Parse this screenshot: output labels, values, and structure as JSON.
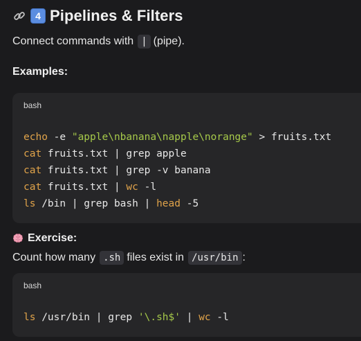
{
  "header": {
    "title": "Pipelines & Filters",
    "badge": "4"
  },
  "intro": {
    "prefix": "Connect commands with",
    "pipe": "|",
    "suffix": "(pipe)."
  },
  "examples": {
    "heading": "Examples:",
    "lang": "bash",
    "lines": [
      {
        "kw": "echo",
        "rest": " -e ",
        "str": "\"apple\\nbanana\\napple\\norange\"",
        "tail": " > fruits.txt"
      },
      {
        "kw": "cat",
        "rest": " fruits.txt | grep apple",
        "str": "",
        "tail": ""
      },
      {
        "kw": "cat",
        "rest": " fruits.txt | grep -v banana",
        "str": "",
        "tail": ""
      },
      {
        "kw": "cat",
        "rest": " fruits.txt | ",
        "kw2": "wc",
        "tail": " -l"
      },
      {
        "kw": "ls",
        "rest": " /bin | grep bash | ",
        "kw2": "head",
        "tail": " -5"
      }
    ]
  },
  "exercise": {
    "heading": "Exercise:",
    "prefix": "Count how many",
    "code1": ".sh",
    "middle": "files exist in",
    "code2": "/usr/bin",
    "suffix": ":",
    "lang": "bash",
    "line": {
      "kw": "ls",
      "rest": " /usr/bin | grep ",
      "str": "'\\.sh$'",
      "mid": " | ",
      "kw2": "wc",
      "tail": " -l"
    }
  },
  "colors": {
    "keyword": "#e0a34a",
    "string": "#a6c94a",
    "code_bg": "#262628"
  }
}
